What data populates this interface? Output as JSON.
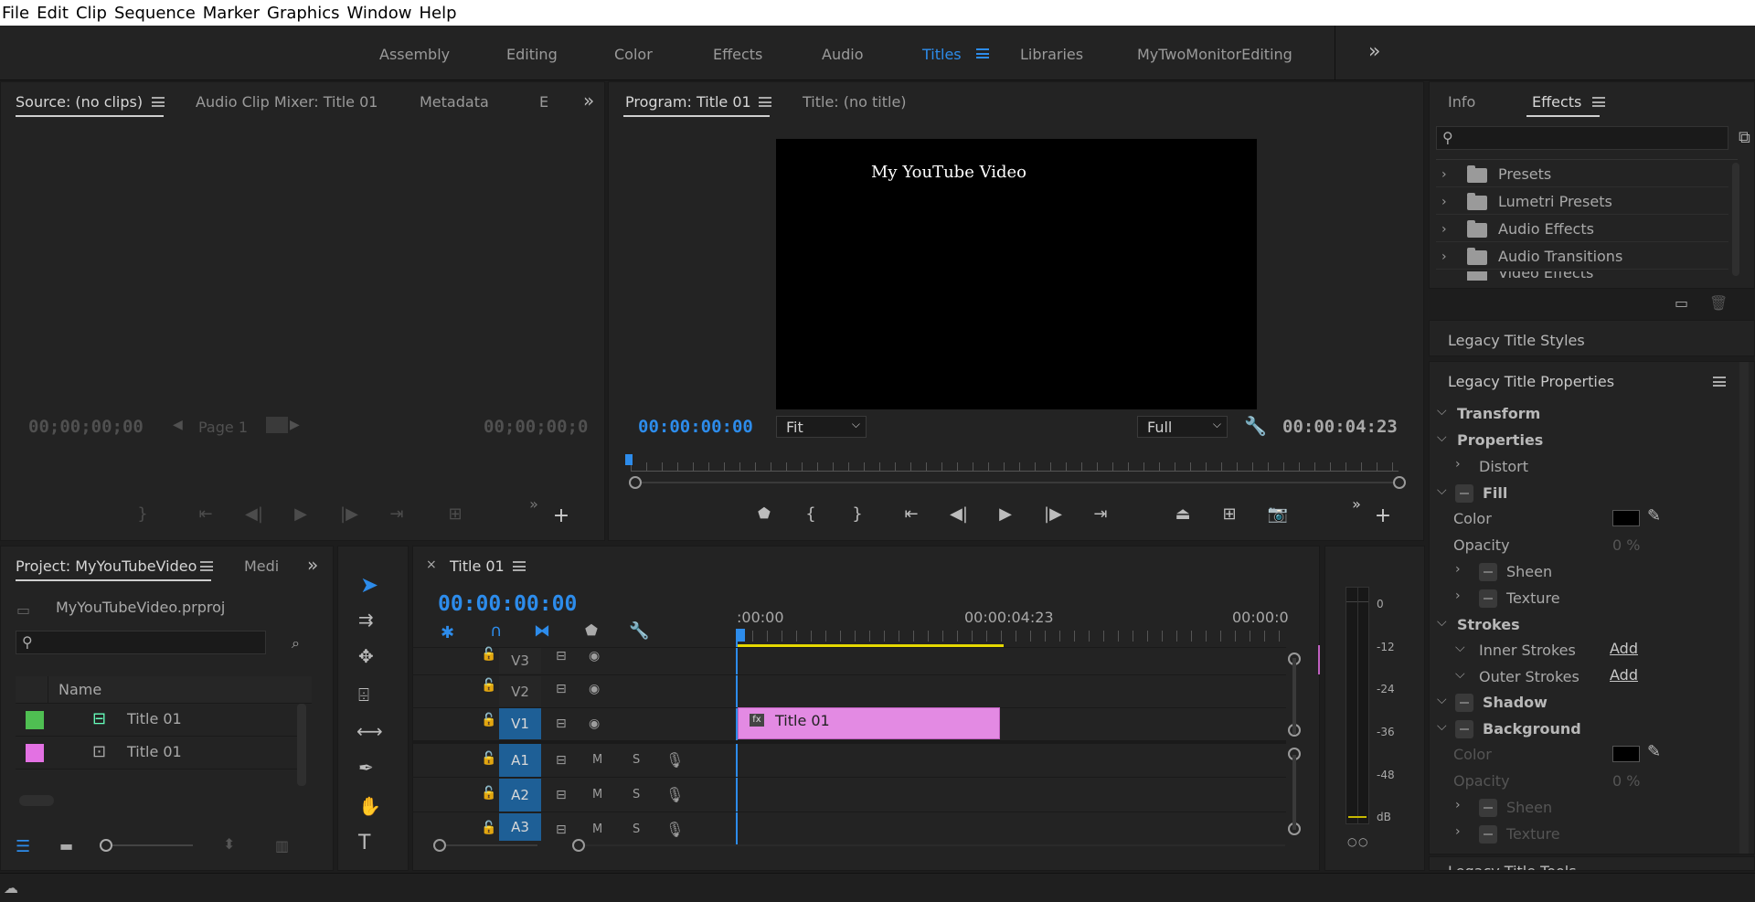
{
  "menu": [
    "File",
    "Edit",
    "Clip",
    "Sequence",
    "Marker",
    "Graphics",
    "Window",
    "Help"
  ],
  "workspaces": {
    "items": [
      "Assembly",
      "Editing",
      "Color",
      "Effects",
      "Audio",
      "Titles",
      "Libraries",
      "MyTwoMonitorEditing"
    ],
    "active": "Titles",
    "more": "»"
  },
  "source": {
    "tabs": [
      "Source: (no clips)",
      "Audio Clip Mixer: Title 01",
      "Metadata",
      "E"
    ],
    "tc_left": "00;00;00;00",
    "tc_right": "00;00;00;0",
    "page": "Page 1"
  },
  "program": {
    "tabs": [
      "Program: Title 01",
      "Title: (no title)"
    ],
    "overlay_text": "My YouTube Video",
    "tc_current": "00:00:00:00",
    "fit": "Fit",
    "quality": "Full",
    "tc_duration": "00:00:04:23"
  },
  "effects": {
    "tabs": [
      "Info",
      "Effects"
    ],
    "search_placeholder": "",
    "items": [
      "Presets",
      "Lumetri Presets",
      "Audio Effects",
      "Audio Transitions",
      "Video Effects"
    ]
  },
  "legacy": {
    "styles_label": "Legacy Title Styles",
    "props_label": "Legacy Title Properties",
    "transform": "Transform",
    "properties": "Properties",
    "distort": "Distort",
    "fill": "Fill",
    "color": "Color",
    "opacity": "Opacity",
    "opacity_val": "0 %",
    "sheen": "Sheen",
    "texture": "Texture",
    "strokes": "Strokes",
    "inner_strokes": "Inner Strokes",
    "outer_strokes": "Outer Strokes",
    "add": "Add",
    "shadow": "Shadow",
    "background": "Background",
    "bg_color": "Color",
    "bg_opacity": "Opacity",
    "bg_opacity_val": "0 %",
    "bg_sheen": "Sheen",
    "bg_texture": "Texture",
    "tools_label": "Legacy Title Tools"
  },
  "project": {
    "tabs": [
      "Project: MyYouTubeVideo",
      "Medi"
    ],
    "file": "MyYouTubeVideo.prproj",
    "col_name": "Name",
    "items": [
      {
        "name": "Title 01",
        "color": "#4fbf52"
      },
      {
        "name": "Title 01",
        "color": "#e371e3"
      }
    ]
  },
  "timeline": {
    "tab": "Title 01",
    "tc": "00:00:00:00",
    "ruler": [
      ":00:00",
      "00:00:04:23",
      "00:00:0"
    ],
    "tracks": [
      "V3",
      "V2",
      "V1",
      "A1",
      "A2",
      "A3"
    ],
    "clip": "Title 01",
    "clip_color": "#e38ae3",
    "mute": "M",
    "solo": "S"
  },
  "meter": {
    "labels": [
      "0",
      "-12",
      "-24",
      "-36",
      "-48",
      "dB"
    ]
  },
  "colors": {
    "accent": "#2d8ceb",
    "panel": "#232323",
    "bg": "#1d1d1d"
  }
}
